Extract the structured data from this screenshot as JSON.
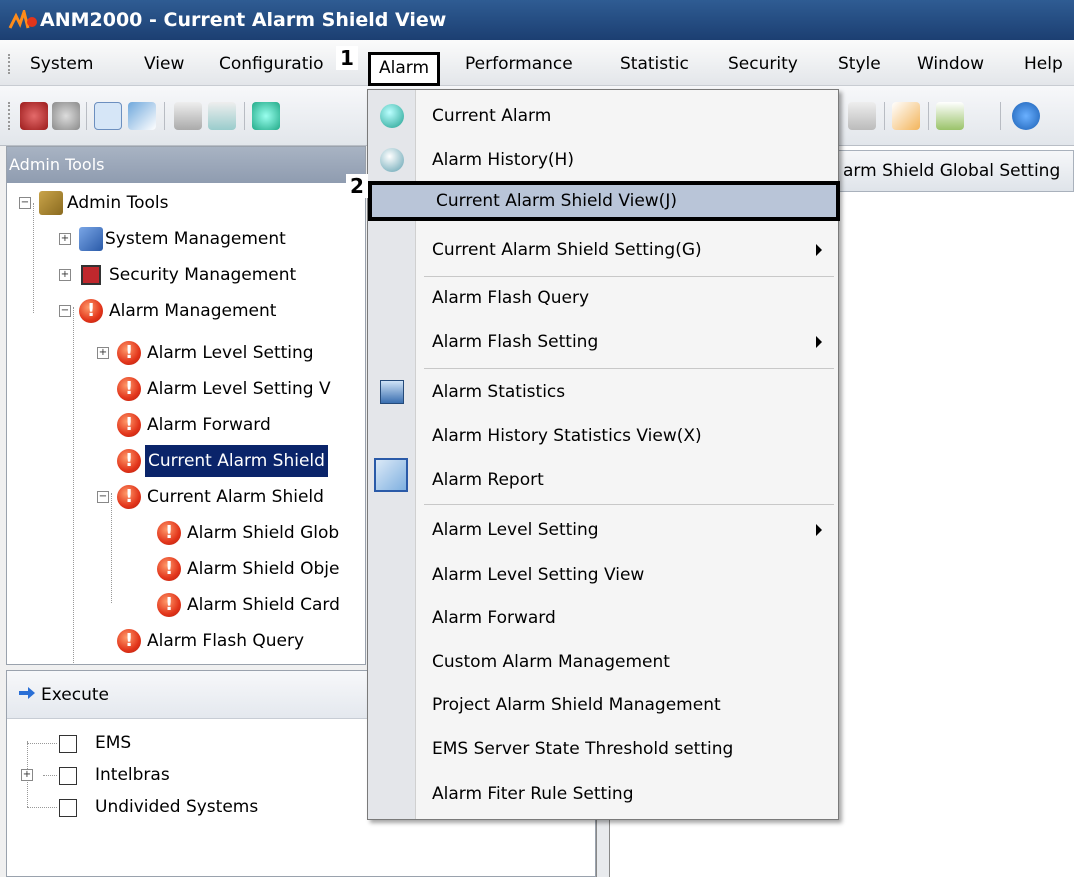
{
  "window": {
    "title": "ANM2000 - Current Alarm Shield View"
  },
  "menubar": {
    "items": [
      "System",
      "View",
      "Configuratio",
      "Alarm",
      "Performance",
      "Statistic",
      "Security",
      "Style",
      "Window",
      "Help"
    ]
  },
  "callouts": {
    "step1": "1",
    "step2": "2"
  },
  "left_panel": {
    "header": "Admin Tools",
    "tree": [
      {
        "label": "Admin Tools"
      },
      {
        "label": "System Management"
      },
      {
        "label": "Security Management"
      },
      {
        "label": "Alarm Management"
      },
      {
        "label": "Alarm Level Setting"
      },
      {
        "label": "Alarm Level Setting V"
      },
      {
        "label": "Alarm Forward"
      },
      {
        "label": "Current Alarm Shield"
      },
      {
        "label": "Current Alarm Shield"
      },
      {
        "label": "Alarm Shield Glob"
      },
      {
        "label": "Alarm Shield Obje"
      },
      {
        "label": "Alarm Shield Card"
      },
      {
        "label": "Alarm Flash Query"
      }
    ]
  },
  "execute_panel": {
    "header": "Execute",
    "items": [
      "EMS",
      "Intelbras",
      "Undivided Systems"
    ]
  },
  "right_tab": {
    "label": "arm Shield Global Setting"
  },
  "alarm_menu": {
    "items": [
      "Current Alarm",
      "Alarm History(H)",
      "Current Alarm Shield View(J)",
      "Current Alarm Shield Setting(G)",
      "Alarm Flash Query",
      "Alarm Flash Setting",
      "Alarm Statistics",
      "Alarm History Statistics View(X)",
      "Alarm Report",
      "Alarm Level Setting",
      "Alarm Level Setting View",
      "Alarm Forward",
      "Custom Alarm Management",
      "Project Alarm Shield Management",
      "EMS Server State Threshold setting",
      "Alarm Fiter Rule Setting"
    ]
  },
  "colors": {
    "selection": "#0a246a",
    "title_bar": "#1c3f72",
    "menu_highlight": "#b9c5d8",
    "alarm_icon": "#e2351b"
  }
}
